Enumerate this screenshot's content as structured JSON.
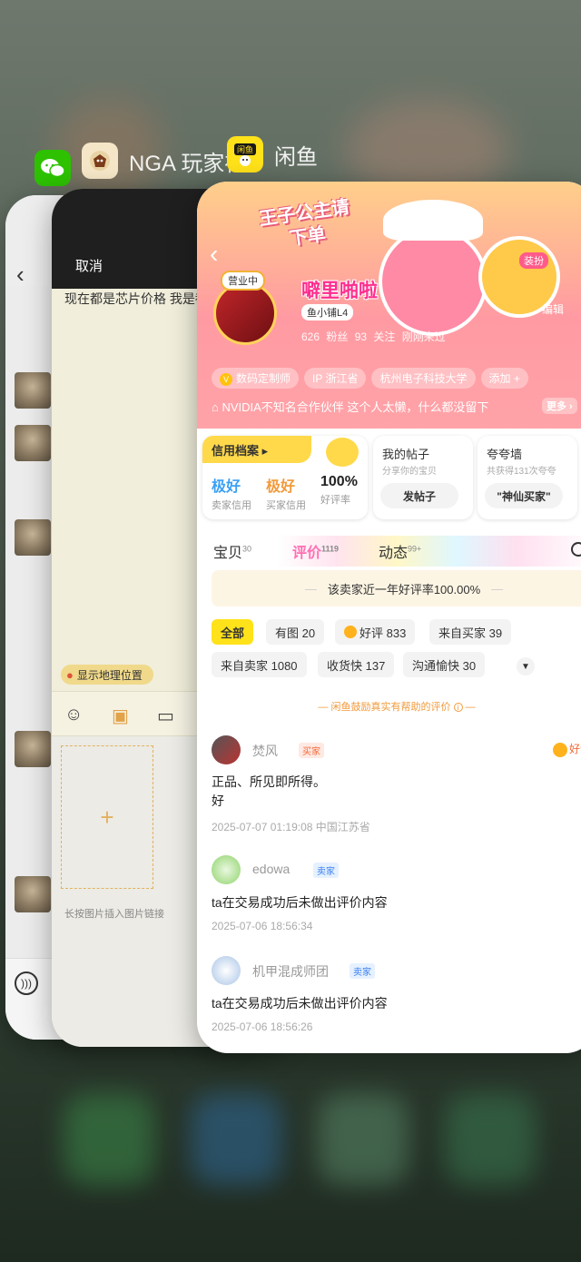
{
  "apps": [
    {
      "name": "",
      "icon": "wechat-icon",
      "color": "#2dc100"
    },
    {
      "name": "NGA 玩家社",
      "icon": "nga-icon",
      "color": "#f5e6c8"
    },
    {
      "name": "闲鱼",
      "icon": "xianyu-icon",
      "color": "#ffe21a"
    }
  ],
  "nga": {
    "cancel_label": "取消",
    "draft_text": "现在都是芯片价格 我是都一样",
    "location_label": "显示地理位置",
    "image_hint": "长按图片插入图片链接"
  },
  "xianyu": {
    "banner": "王子公主请下单",
    "user_badge": "营业中",
    "username": "噼里啪啦",
    "level": "鱼小铺L4",
    "mascot_label": "装扮",
    "stats": "626 粉丝   93 关注   刚刚来过",
    "edit_label": "编辑",
    "tags": [
      "数码定制师",
      "IP 浙江省",
      "杭州电子科技大学",
      "添加 +"
    ],
    "bio": "NVIDIA不知名合作伙伴    这个人太懒，什么都没留下",
    "more_label": "更多",
    "credit": {
      "title": "信用档案",
      "seller_value": "极好",
      "seller_label": "卖家信用",
      "buyer_value": "极好",
      "buyer_label": "买家信用",
      "rate_value": "100%",
      "rate_label": "好评率"
    },
    "posts": {
      "title": "我的帖子",
      "subtitle": "分享你的宝贝",
      "button": "发帖子"
    },
    "praise": {
      "title": "夸夸墙",
      "subtitle": "共获得131次夸夸",
      "button": "\"神仙买家\""
    },
    "tabs": [
      {
        "label": "宝贝",
        "count": "30"
      },
      {
        "label": "评价",
        "count": "1119"
      },
      {
        "label": "动态",
        "count": "99+"
      }
    ],
    "rate_banner": "该卖家近一年好评率100.00%",
    "filters": [
      {
        "label": "全部"
      },
      {
        "label": "有图 20"
      },
      {
        "label": "好评 833"
      },
      {
        "label": "来自买家 39"
      },
      {
        "label": "来自卖家 1080"
      },
      {
        "label": "收货快 137"
      },
      {
        "label": "沟通愉快 30"
      }
    ],
    "encourage": "闲鱼鼓励真实有帮助的评价",
    "reviews": [
      {
        "name": "焚风",
        "role": "买家",
        "good": "好评",
        "text": "正品、所见即所得。\n好",
        "time": "2025-07-07 01:19:08 中国江苏省"
      },
      {
        "name": "edowa",
        "role": "卖家",
        "good": "",
        "text": "ta在交易成功后未做出评价内容",
        "time": "2025-07-06 18:56:34"
      },
      {
        "name": "机甲混成师团",
        "role": "卖家",
        "good": "",
        "text": "ta在交易成功后未做出评价内容",
        "time": "2025-07-06 18:56:26"
      }
    ]
  },
  "colors": {
    "accent_pink": "#ff6fb3",
    "credit_blue": "#3aa0f5",
    "credit_orange": "#f29a3b",
    "chip_yellow": "#ffe21a"
  }
}
